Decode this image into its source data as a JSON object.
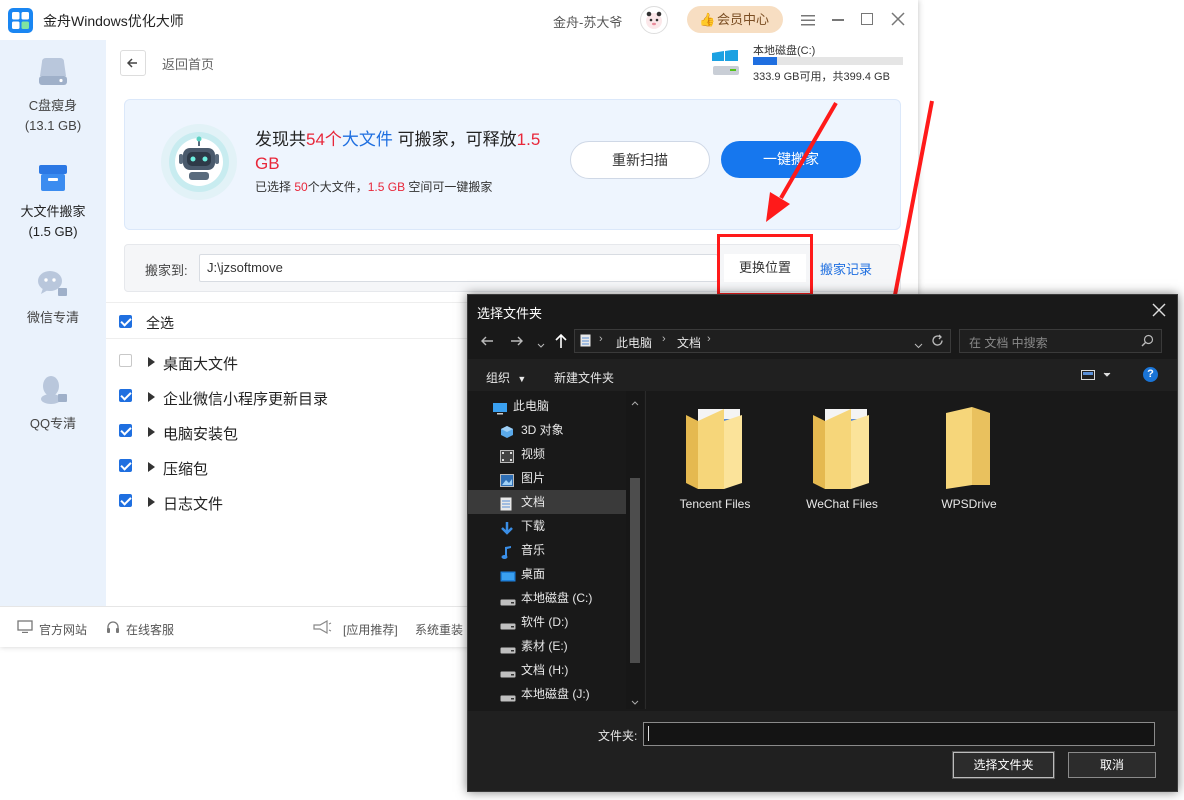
{
  "app": {
    "title": "金舟Windows优化大师",
    "user": "金舟-苏大爷",
    "vip_label": "会员中心",
    "window_controls": [
      "menu-icon",
      "minimize-icon",
      "maximize-icon",
      "close-icon"
    ]
  },
  "sidebar": {
    "items": [
      {
        "label": "C盘瘦身",
        "sub": "(13.1 GB)",
        "icon": "disk-icon"
      },
      {
        "label": "大文件搬家",
        "sub": "(1.5 GB)",
        "icon": "box-icon"
      },
      {
        "label": "微信专清",
        "sub": "",
        "icon": "wechat-icon"
      },
      {
        "label": "QQ专清",
        "sub": "",
        "icon": "qq-icon"
      }
    ]
  },
  "header": {
    "back_label": "返回首页",
    "disk_name": "本地磁盘(C:)",
    "disk_usage": "333.9 GB可用，共399.4 GB",
    "disk_used_fraction": 0.16
  },
  "banner": {
    "pre": "发现共",
    "count": "54个",
    "mid1": "大文件",
    "mid2": " 可搬家，可释放",
    "size": "1.5 GB",
    "sub_pre": "已选择 ",
    "sub_count": "50",
    "sub_mid": "个大文件，",
    "sub_size": "1.5 GB",
    "sub_post": " 空间可一键搬家",
    "rescan": "重新扫描",
    "move_all": "一键搬家"
  },
  "move_to": {
    "label": "搬家到:",
    "path": "J:\\jzsoftmove",
    "change": "更换位置",
    "history": "搬家记录"
  },
  "list": {
    "select_all": "全选",
    "items": [
      {
        "label": "桌面大文件",
        "checked": false
      },
      {
        "label": "企业微信小程序更新目录",
        "checked": true
      },
      {
        "label": "电脑安装包",
        "checked": true
      },
      {
        "label": "压缩包",
        "checked": true
      },
      {
        "label": "日志文件",
        "checked": true
      }
    ]
  },
  "footer": {
    "website": "官方网站",
    "service": "在线客服",
    "recommend": "[应用推荐]",
    "reinstall": "系统重装"
  },
  "dialog": {
    "title": "选择文件夹",
    "path": [
      "此电脑",
      "文档"
    ],
    "search_placeholder": "在 文档 中搜索",
    "organize": "组织",
    "new_folder": "新建文件夹",
    "nav": [
      {
        "label": "此电脑",
        "icon": "pc-icon"
      },
      {
        "label": "3D 对象",
        "icon": "3d-icon"
      },
      {
        "label": "视频",
        "icon": "video-icon"
      },
      {
        "label": "图片",
        "icon": "picture-icon"
      },
      {
        "label": "文档",
        "icon": "document-icon"
      },
      {
        "label": "下载",
        "icon": "download-icon"
      },
      {
        "label": "音乐",
        "icon": "music-icon"
      },
      {
        "label": "桌面",
        "icon": "desktop-icon"
      },
      {
        "label": "本地磁盘 (C:)",
        "icon": "drive-icon"
      },
      {
        "label": "软件 (D:)",
        "icon": "drive-icon"
      },
      {
        "label": "素材 (E:)",
        "icon": "drive-icon"
      },
      {
        "label": "文档 (H:)",
        "icon": "drive-icon"
      },
      {
        "label": "本地磁盘 (J:)",
        "icon": "drive-icon"
      }
    ],
    "folders": [
      "Tencent Files",
      "WeChat Files",
      "WPSDrive"
    ],
    "filename_label": "文件夹:",
    "filename_value": "",
    "select_button": "选择文件夹",
    "cancel_button": "取消"
  },
  "colors": {
    "accent": "#1f6fe0",
    "highlight_red": "#e8273a",
    "annotation_red": "#ff1a1a",
    "dialog_bg": "#191919"
  }
}
